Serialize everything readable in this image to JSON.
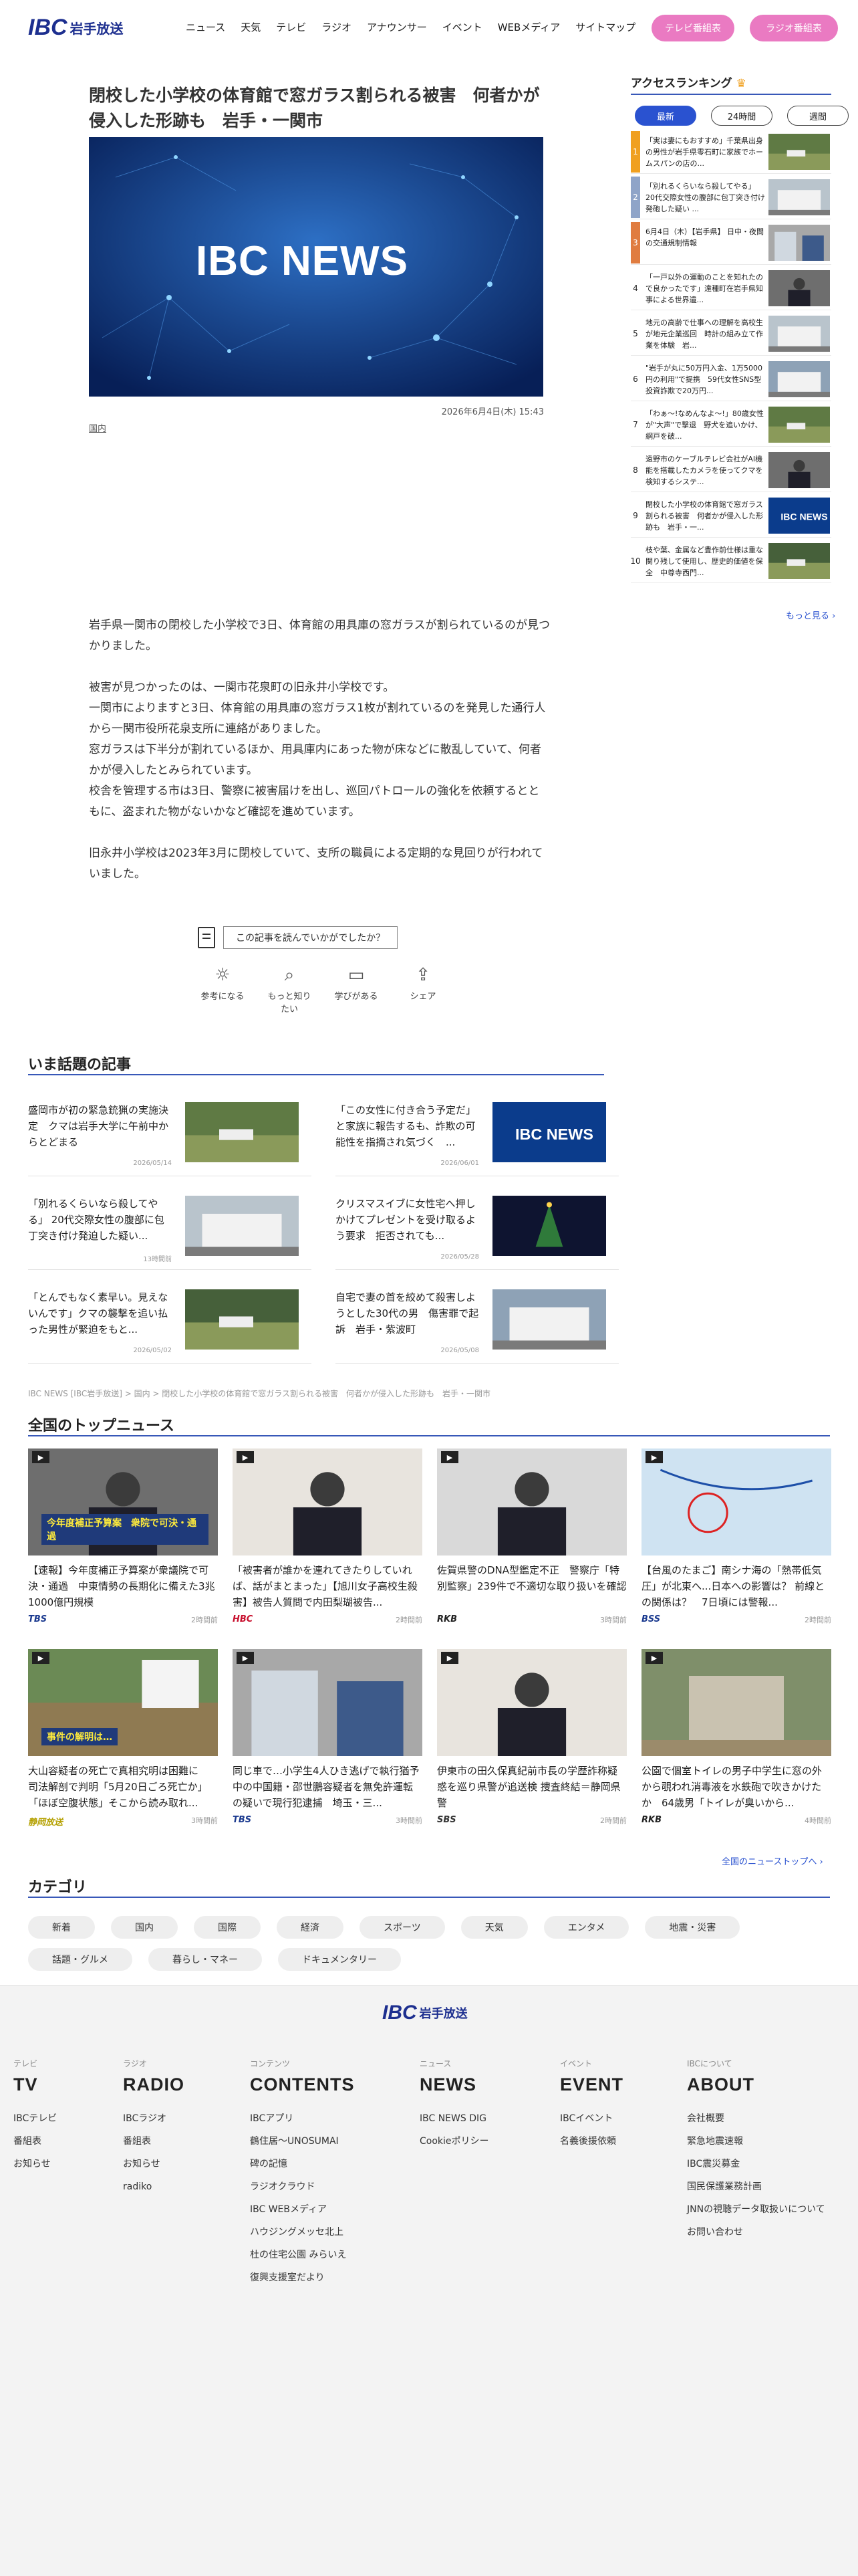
{
  "header": {
    "logo_mark": "IBC",
    "logo_text": "岩手放送",
    "nav": [
      "ニュース",
      "天気",
      "テレビ",
      "ラジオ",
      "アナウンサー",
      "イベント",
      "WEBメディア",
      "サイトマップ"
    ],
    "tv_button": "テレビ番組表",
    "radio_button": "ラジオ番組表"
  },
  "article": {
    "title": "閉校した小学校の体育館で窓ガラス割られる被害　何者かが侵入した形跡も　岩手・一関市",
    "hero_logo": "IBC NEWS",
    "date": "2026年6月4日(木) 15:43",
    "category": "国内",
    "paragraphs": [
      "岩手県一関市の閉校した小学校で3日、体育館の用具庫の窓ガラスが割られているのが見つかりました。",
      "被害が見つかったのは、一関市花泉町の旧永井小学校です。\n一関市によりますと3日、体育館の用具庫の窓ガラス1枚が割れているのを発見した通行人から一関市役所花泉支所に連絡がありました。\n窓ガラスは下半分が割れているほか、用具庫内にあった物が床などに散乱していて、何者かが侵入したとみられています。\n校舎を管理する市は3日、警察に被害届けを出し、巡回パトロールの強化を依頼するとともに、盗まれた物がないかなど確認を進めています。",
      "旧永井小学校は2023年3月に閉校していて、支所の職員による定期的な見回りが行われていました。"
    ],
    "feedback_prompt": "この記事を読んでいかがでしたか？",
    "reactions": [
      {
        "icon": "lightbulb-icon",
        "label": "参考になる"
      },
      {
        "icon": "magnifier-icon",
        "label": "もっと知りたい"
      },
      {
        "icon": "book-icon",
        "label": "学びがある"
      },
      {
        "icon": "share-icon",
        "label": "シェア"
      }
    ]
  },
  "ranking": {
    "title": "アクセスランキング",
    "tabs": [
      "最新",
      "24時間",
      "週間"
    ],
    "active_tab": "最新",
    "items": [
      {
        "rank": "1",
        "text": "「実は妻にもおすすめ」千葉県出身の男性が岩手県零石町に家族でホームスパンの店の..."
      },
      {
        "rank": "2",
        "text": "「別れるくらいなら殺してやる」 20代交際女性の腹部に包丁突き付け発砲した疑い ..."
      },
      {
        "rank": "3",
        "text": "6月4日（木）【岩手県】 日中・夜間の交通規制情報"
      },
      {
        "rank": "4",
        "text": "「一戸以外の運動のことを知れたので良かったです」遠種町在岩手県知事による世界遺..."
      },
      {
        "rank": "5",
        "text": "地元の高齢で仕事への理解を高校生が地元企業巡回　時計の組み立て作業を体験　岩..."
      },
      {
        "rank": "6",
        "text": "\"岩手が丸に50万円入金、1万5000円の利用\"で提携　59代女性SNS型投資詐欺で20万円..."
      },
      {
        "rank": "7",
        "text": "「わぁ〜!なめんなよ〜!」80歳女性が\"大声\"で撃退　野犬を追いかけ、網戸を破..."
      },
      {
        "rank": "8",
        "text": "遠野市のケーブルテレビ会社がAI機能を搭載したカメラを使ってクマを検知するシステ..."
      },
      {
        "rank": "9",
        "text": "閉校した小学校の体育館で窓ガラス割られる被害　何者かが侵入した形跡も　岩手・一..."
      },
      {
        "rank": "10",
        "text": "枝や葉、金属など豊作前仕様は重な関り残して使用し、歴史的価値を保全　中尊寺西門..."
      }
    ],
    "more": "もっと見る ›"
  },
  "topics": {
    "title": "いま話題の記事",
    "items": [
      {
        "text": "盛岡市が初の緊急銃猟の実施決定　クマは岩手大学に午前中からとどまる",
        "date": "2026/05/14"
      },
      {
        "text": "「この女性に付き合う予定だ」と家族に報告するも、詐欺の可能性を指摘され気づく　...",
        "date": "2026/06/01"
      },
      {
        "text": "「別れるくらいなら殺してやる」 20代交際女性の腹部に包丁突き付け発迫した疑い...",
        "date": "13時間前"
      },
      {
        "text": "クリスマスイブに女性宅へ押しかけてプレゼントを受け取るよう要求　拒否されても...",
        "date": "2026/05/28"
      },
      {
        "text": "「とんでもなく素早い。見えないんです」クマの襲撃を追い払った男性が緊迫をもと...",
        "date": "2026/05/02"
      },
      {
        "text": "自宅で妻の首を絞めて殺害しようとした30代の男　傷害罪で起訴　岩手・紫波町",
        "date": "2026/05/08"
      }
    ]
  },
  "breadcrumb": "IBC NEWS [IBC岩手放送] > 国内 > 閉校した小学校の体育館で窓ガラス割られる被害　何者かが侵入した形跡も　岩手・一関市",
  "national": {
    "title": "全国のトップニュース",
    "items": [
      {
        "text": "【速報】今年度補正予算案が衆議院で可決・通過　中東情勢の長期化に備えた3兆1000億円規模",
        "source": "TBS",
        "time": "2時間前",
        "color": "#1b3a8f",
        "caption": "今年度補正予算案　衆院で可決・通過"
      },
      {
        "text": "「被害者が誰かを連れてきたりしていれば、話がまとまった」【旭川女子高校生殺害】被告人質問で内田梨瑚被告...",
        "source": "HBC",
        "time": "2時間前",
        "color": "#c8102e",
        "caption": ""
      },
      {
        "text": "佐賀県警のDNA型鑑定不正　警察庁「特別監察」239件で不適切な取り扱いを確認",
        "source": "RKB",
        "time": "3時間前",
        "color": "#222222",
        "caption": ""
      },
      {
        "text": "【台風のたまご】南シナ海の「熱帯低気圧」が北東へ...日本への影響は？ 前線との関係は？　7日頃には警報...",
        "source": "BSS",
        "time": "2時間前",
        "color": "#1b3a8f",
        "caption": ""
      },
      {
        "text": "大山容疑者の死亡で真相究明は困難に　司法解剖で判明「5月20日ごろ死亡か」「ほぼ空腹状態」そこから読み取れ...",
        "source": "静岡放送",
        "time": "3時間前",
        "color": "#b4a000",
        "caption": "事件の解明は…"
      },
      {
        "text": "同じ車で…小学生4人ひき逃げで執行猶予中の中国籍・邵世鵬容疑者を無免許運転の疑いで現行犯逮捕　埼玉・三...",
        "source": "TBS",
        "time": "3時間前",
        "color": "#1b3a8f",
        "caption": ""
      },
      {
        "text": "伊東市の田久保真紀前市長の学歴詐称疑惑を巡り県警が追送検 捜査終結＝静岡県警",
        "source": "SBS",
        "time": "2時間前",
        "color": "#333333",
        "caption": ""
      },
      {
        "text": "公園で個室トイレの男子中学生に窓の外から覗われ消毒液を水鉄砲で吹きかけたか　64歳男「トイレが臭いから...",
        "source": "RKB",
        "time": "4時間前",
        "color": "#222222",
        "caption": ""
      }
    ],
    "more": "全国のニューストップへ ›"
  },
  "categories": {
    "title": "カテゴリ",
    "items": [
      "新着",
      "国内",
      "国際",
      "経済",
      "スポーツ",
      "天気",
      "エンタメ",
      "地震・災害",
      "話題・グルメ",
      "暮らし・マネー",
      "ドキュメンタリー"
    ]
  },
  "footer": {
    "logo_mark": "IBC",
    "logo_text": "岩手放送",
    "columns": [
      {
        "small": "テレビ",
        "big": "TV",
        "links": [
          "IBCテレビ",
          "番組表",
          "お知らせ"
        ]
      },
      {
        "small": "ラジオ",
        "big": "RADIO",
        "links": [
          "IBCラジオ",
          "番組表",
          "お知らせ",
          "radiko"
        ]
      },
      {
        "small": "コンテンツ",
        "big": "CONTENTS",
        "links": [
          "IBCアプリ",
          "鶴住居〜UNOSUMAI",
          "碑の記憶",
          "ラジオクラウド",
          "IBC WEBメディア",
          "ハウジングメッセ北上",
          "杜の住宅公園 みらいえ",
          "復興支援室だより"
        ]
      },
      {
        "small": "ニュース",
        "big": "NEWS",
        "links": [
          "IBC NEWS DIG",
          "Cookieポリシー"
        ]
      },
      {
        "small": "イベント",
        "big": "EVENT",
        "links": [
          "IBCイベント",
          "名義後援依頼"
        ]
      },
      {
        "small": "IBCについて",
        "big": "ABOUT",
        "links": [
          "会社概要",
          "緊急地震速報",
          "IBC震災募金",
          "国民保護業務計画",
          "JNNの視聴データ取扱いについて",
          "お問い合わせ"
        ]
      }
    ]
  },
  "colors": {
    "brand": "#1d2f8f",
    "accent_pink": "#ea7ac2",
    "link_blue": "#2a52d0",
    "rank_top": "#f0a020"
  }
}
